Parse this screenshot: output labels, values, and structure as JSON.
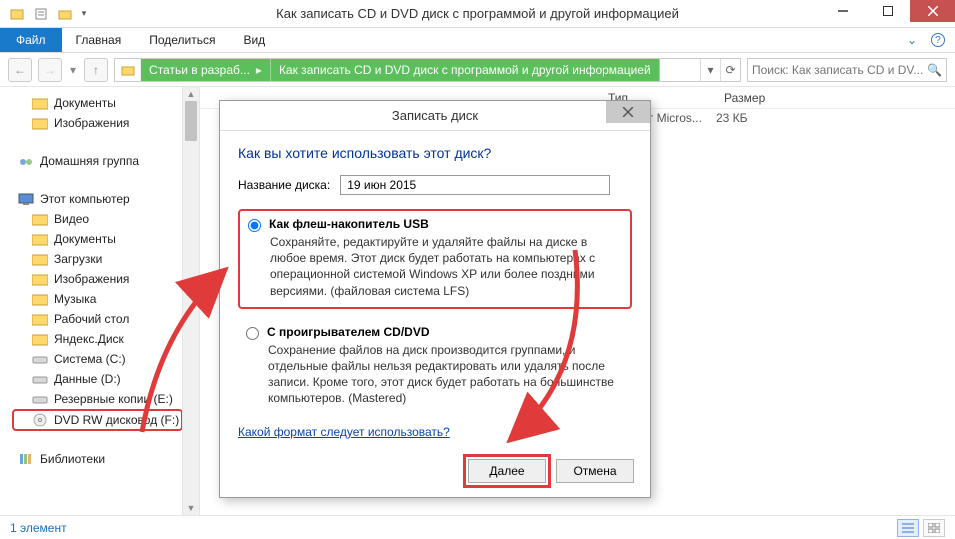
{
  "window": {
    "title": "Как записать CD и DVD диск с программой и другой информацией"
  },
  "ribbon": {
    "file": "Файл",
    "tabs": [
      "Главная",
      "Поделиться",
      "Вид"
    ]
  },
  "breadcrumb": {
    "seg1": "Статьи в разраб...",
    "seg2": "Как записать CD и DVD диск с программой и другой информацией"
  },
  "search": {
    "placeholder": "Поиск: Как записать CD и DV..."
  },
  "columns": {
    "type": "Тип",
    "size": "Размер"
  },
  "filerow": {
    "type": "Документ Micros...",
    "size": "23 КБ"
  },
  "tree": {
    "documents": "Документы",
    "images": "Изображения",
    "homegroup": "Домашняя группа",
    "thispc": "Этот компьютер",
    "video": "Видео",
    "documents2": "Документы",
    "downloads": "Загрузки",
    "images2": "Изображения",
    "music": "Музыка",
    "desktop": "Рабочий стол",
    "yandex": "Яндекс.Диск",
    "system_c": "Система (C:)",
    "data_d": "Данные (D:)",
    "backup_e": "Резервные копии (E:)",
    "dvd_f": "DVD RW дисковод (F:)",
    "libraries": "Библиотеки"
  },
  "dialog": {
    "title": "Записать диск",
    "header": "Как вы хотите использовать этот диск?",
    "name_label": "Название диска:",
    "name_value": "19 июн 2015",
    "opt1_label": "Как флеш-накопитель USB",
    "opt1_desc": "Сохраняйте, редактируйте и удаляйте файлы на диске в любое время. Этот диск будет работать на компьютерах с операционной системой Windows XP или более поздними версиями. (файловая система LFS)",
    "opt2_label": "С проигрывателем CD/DVD",
    "opt2_desc": "Сохранение файлов на диск производится группами, и отдельные файлы нельзя редактировать или удалять после записи. Кроме того, этот диск будет работать на большинстве компьютеров. (Mastered)",
    "help_link": "Какой формат следует использовать?",
    "btn_next": "Далее",
    "btn_cancel": "Отмена"
  },
  "status": {
    "count": "1 элемент"
  }
}
